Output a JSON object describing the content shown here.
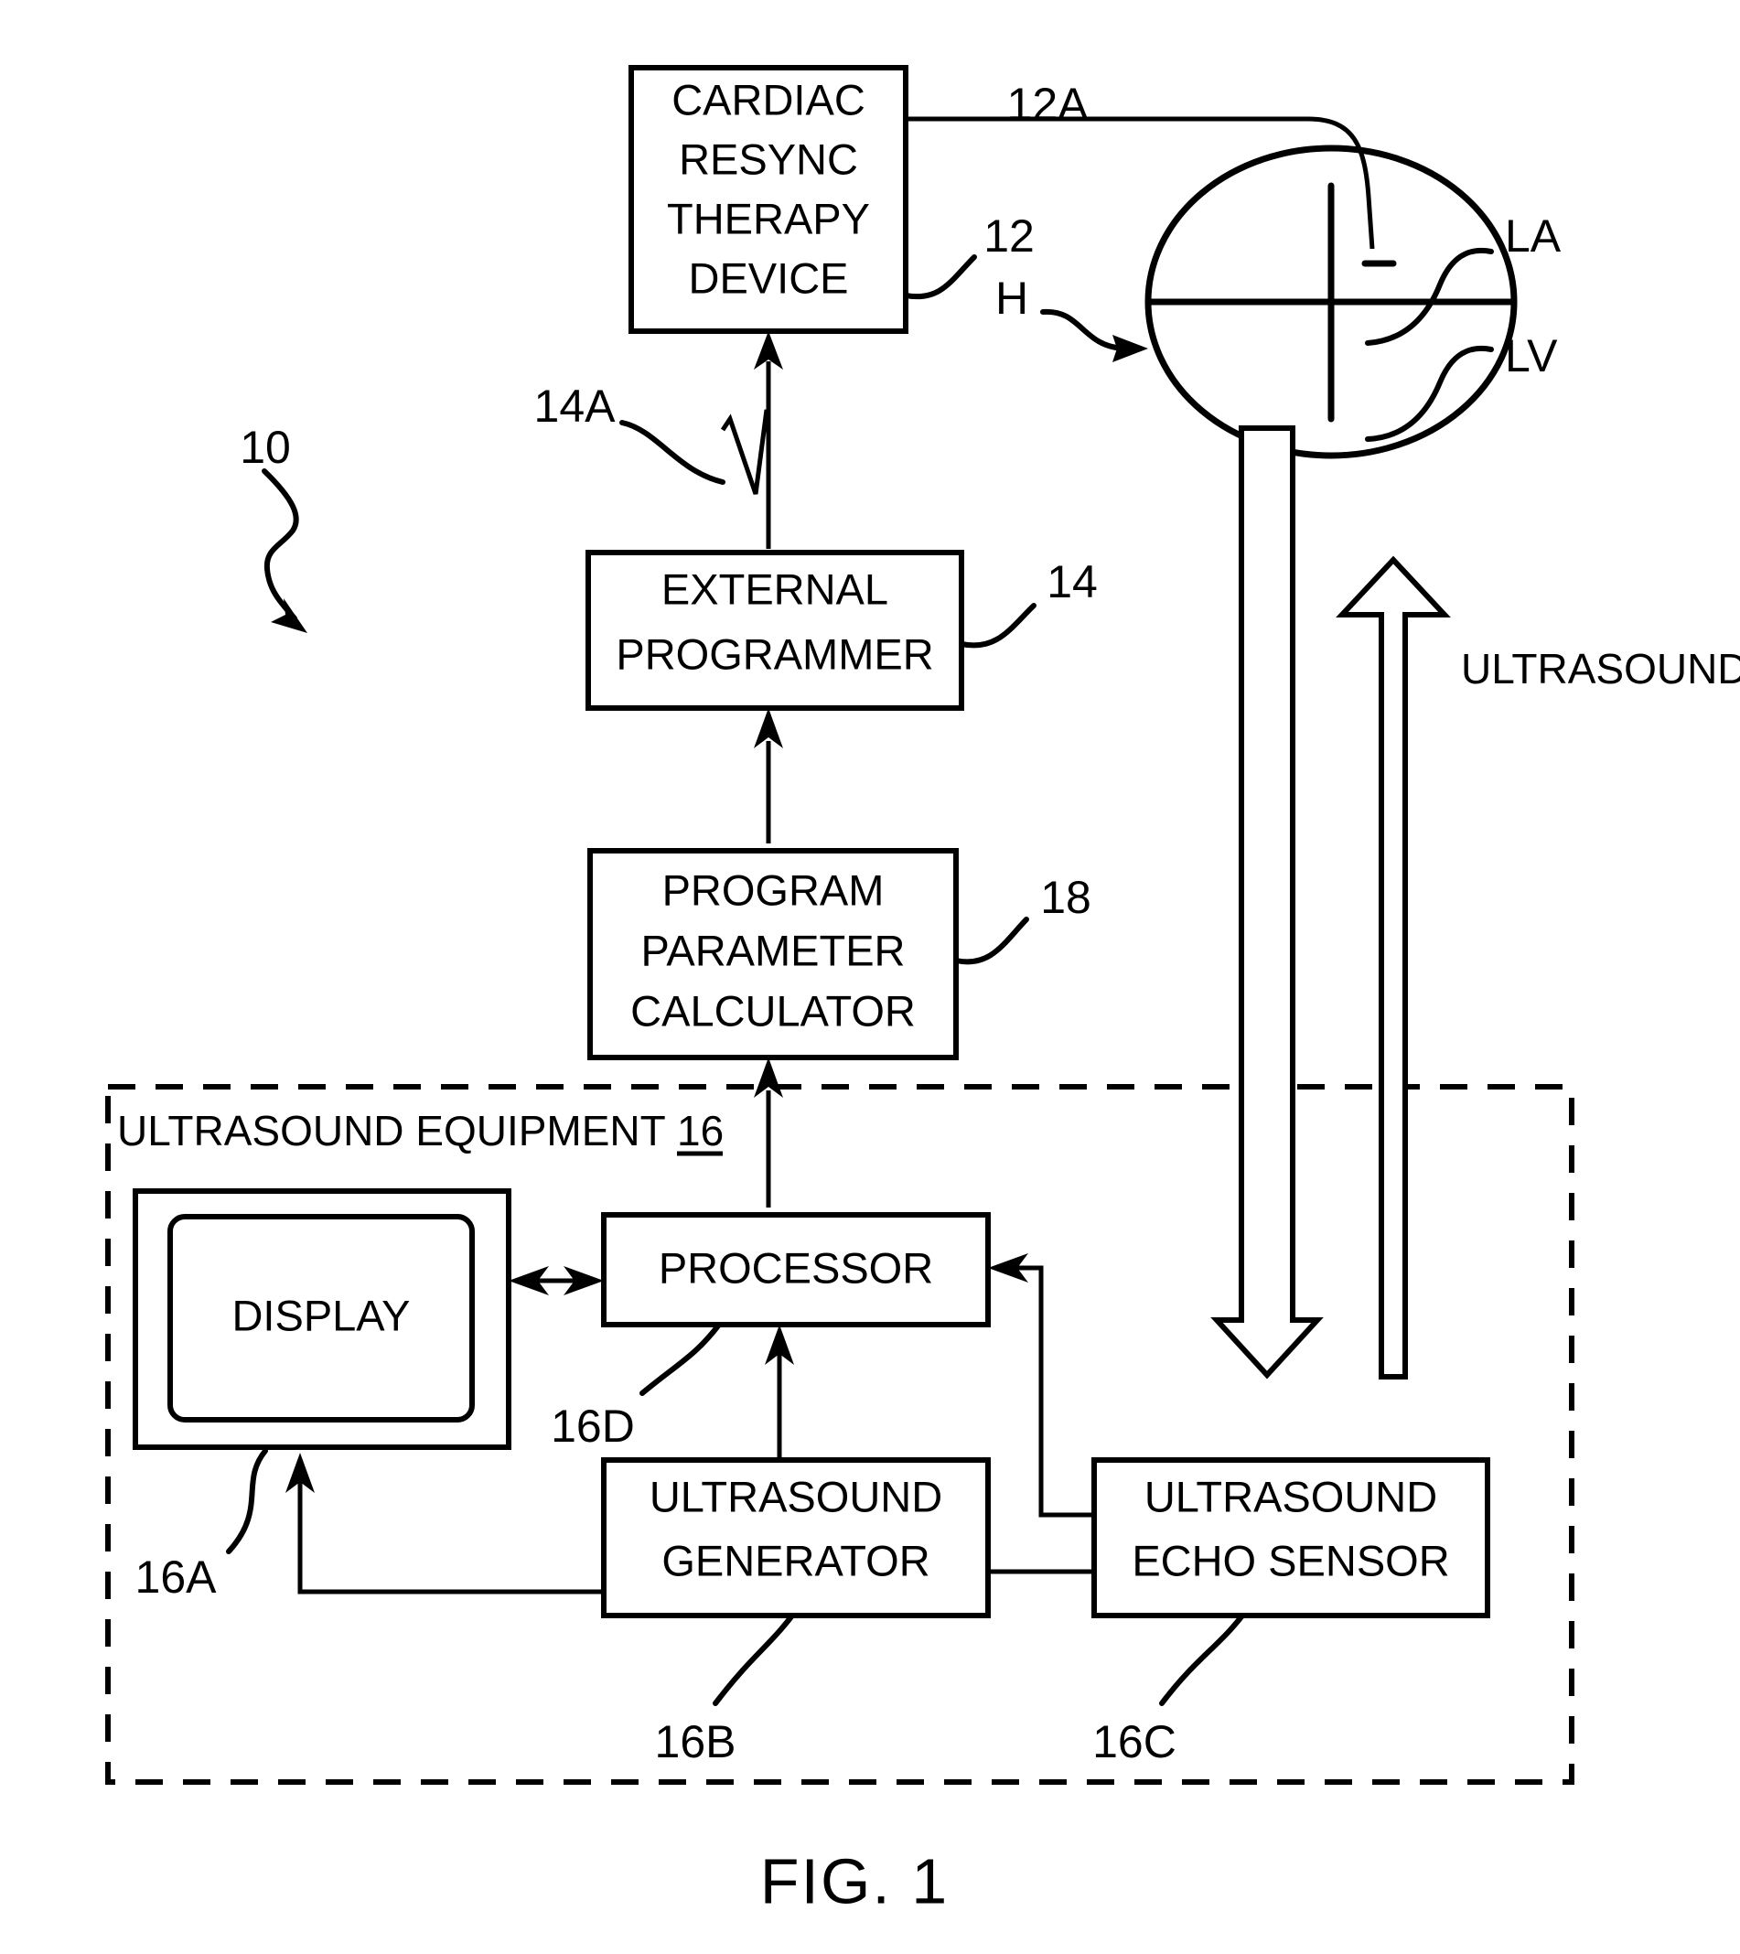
{
  "figure": {
    "caption": "FIG. 1",
    "system_ref": "10"
  },
  "blocks": [
    {
      "id": "crt-device",
      "lines": [
        "CARDIAC",
        "RESYNC",
        "THERAPY",
        "DEVICE"
      ],
      "ref": "12"
    },
    {
      "id": "external-programmer",
      "lines": [
        "EXTERNAL",
        "PROGRAMMER"
      ],
      "ref": "14"
    },
    {
      "id": "program-parameter-calculator",
      "lines": [
        "PROGRAM",
        "PARAMETER",
        "CALCULATOR"
      ],
      "ref": "18"
    },
    {
      "id": "display",
      "lines": [
        "DISPLAY"
      ],
      "ref": "16A"
    },
    {
      "id": "processor",
      "lines": [
        "PROCESSOR"
      ],
      "ref": "16D"
    },
    {
      "id": "ultrasound-generator",
      "lines": [
        "ULTRASOUND",
        "GENERATOR"
      ],
      "ref": "16B"
    },
    {
      "id": "ultrasound-echo-sensor",
      "lines": [
        "ULTRASOUND",
        "ECHO SENSOR"
      ],
      "ref": "16C"
    }
  ],
  "enclosure": {
    "label": "ULTRASOUND EQUIPMENT",
    "ref": "16"
  },
  "anatomy": {
    "heart_label": "H",
    "left_atrium_label": "LA",
    "left_ventricle_label": "LV"
  },
  "annotations": {
    "lead_ref": "12A",
    "telemetry_ref": "14A",
    "ultrasounds_label": "ULTRASOUNDS"
  },
  "colors": {
    "ink": "#000000",
    "paper": "#ffffff"
  }
}
